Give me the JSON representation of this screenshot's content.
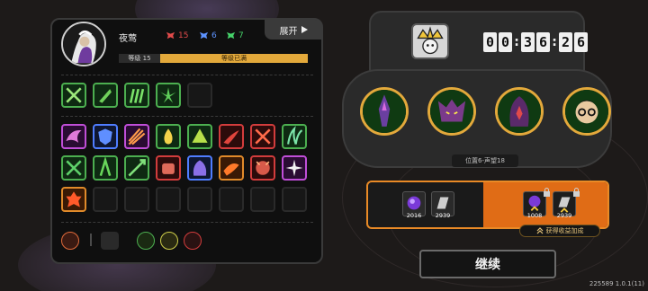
{
  "player": {
    "name": "夜莺",
    "level_label": "等级 15",
    "level_status": "等级已满",
    "expand_label": "展开"
  },
  "resources": {
    "red": "15",
    "blue": "6",
    "green": "7"
  },
  "timer": {
    "digits": [
      "0",
      "0",
      "3",
      "6",
      "2",
      "6"
    ]
  },
  "position_label": "位置6-声望18",
  "rewards": {
    "orb_value": "2016",
    "card_value": "2939",
    "bonus_orb_value": "1008",
    "bonus_card_value": "2939",
    "bonus_tag": "获得收益加成"
  },
  "continue_label": "继续",
  "version": "225589 1.0.1(11)",
  "colors": {
    "accent": "#e3a93b",
    "bonus": "#e06c16",
    "red": "#e24b4b",
    "blue": "#5d93ff",
    "green": "#46d36a"
  }
}
